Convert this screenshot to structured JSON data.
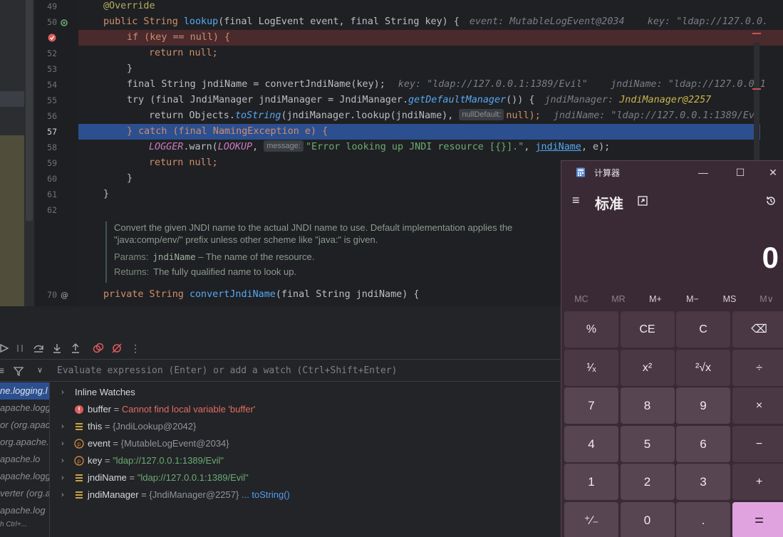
{
  "editor": {
    "lines": [
      {
        "num": "49",
        "top": 0
      },
      {
        "num": "50"
      },
      {
        "num": ""
      },
      {
        "num": "52"
      },
      {
        "num": "53"
      },
      {
        "num": "54"
      },
      {
        "num": "55"
      },
      {
        "num": "56"
      },
      {
        "num": "57"
      },
      {
        "num": "58"
      },
      {
        "num": "59"
      },
      {
        "num": "60"
      },
      {
        "num": "61"
      },
      {
        "num": "62"
      },
      {
        "num": "70"
      }
    ],
    "code": {
      "l49": "@Override",
      "l50_a": "public String ",
      "l50_fn": "lookup",
      "l50_b": "(final LogEvent event, final String key) {",
      "l50_hint": "event: MutableLogEvent@2034    key: \"ldap://127.0.0.",
      "l51": "if (key == null) {",
      "l52": "return null;",
      "l53": "}",
      "l54": "final String jndiName = convertJndiName(key);",
      "l54_hint": "key: \"ldap://127.0.0.1:1389/Evil\"    jndiName: \"ldap://127.0.0.1",
      "l55_a": "try (final JndiManager jndiManager = JndiManager.",
      "l55_fn": "getDefaultManager",
      "l55_b": "()) {",
      "l55_hint_label": "jndiManager: ",
      "l55_hint_obj": "JndiManager@2257",
      "l56_a": "return Objects.",
      "l56_fn": "toString",
      "l56_b": "(jndiManager.lookup(jndiName),",
      "l56_param": "nullDefault:",
      "l56_c": "null);",
      "l56_hint": "jndiName: \"ldap://127.0.0.1:1389/Evi",
      "l57": "} catch (final NamingException e) {",
      "l58_a": "LOGGER",
      "l58_b": ".warn(",
      "l58_c": "LOOKUP",
      "l58_d": ",",
      "l58_param": "message:",
      "l58_str": "\"Error looking up JNDI resource [{}].\"",
      "l58_e": ", ",
      "l58_link": "jndiName",
      "l58_f": ", e);",
      "l59": "return null;",
      "l60": "}",
      "l61": "}",
      "l70_a": "private String ",
      "l70_fn": "convertJndiName",
      "l70_b": "(final String jndiName) {"
    },
    "doc": {
      "line1": "Convert the given JNDI name to the actual JNDI name to use. Default implementation applies the",
      "line2": "\"java:comp/env/\" prefix unless other scheme like \"java:\" is given.",
      "params_label": "Params:",
      "params_code": "jndiName",
      "params_text": " – The name of the resource.",
      "returns_label": "Returns:",
      "returns_text": "The fully qualified name to look up."
    }
  },
  "debug": {
    "eval_placeholder": "Evaluate expression (Enter) or add a watch (Ctrl+Shift+Enter)",
    "frames": [
      "ne.logging.l",
      "apache.logging",
      "or (org.apache",
      "org.apache.",
      "apache.lo",
      "apache.logg",
      "verter (org.a",
      "apache.log",
      "h Ctrl+..."
    ],
    "vars": [
      {
        "name": "Inline Watches",
        "kind": "header"
      },
      {
        "name": "buffer",
        "value": "Cannot find local variable 'buffer'",
        "kind": "error"
      },
      {
        "name": "this",
        "value": "{JndiLookup@2042}",
        "kind": "obj"
      },
      {
        "name": "event",
        "value": "{MutableLogEvent@2034}",
        "kind": "param"
      },
      {
        "name": "key",
        "value": "\"ldap://127.0.0.1:1389/Evil\"",
        "kind": "param-str"
      },
      {
        "name": "jndiName",
        "value": "\"ldap://127.0.0.1:1389/Evil\"",
        "kind": "str"
      },
      {
        "name": "jndiManager",
        "value": "{JndiManager@2257}",
        "link": "... toString()",
        "kind": "obj"
      }
    ]
  },
  "calculator": {
    "title": "计算器",
    "mode": "标准",
    "display": "0",
    "memory": [
      "MC",
      "MR",
      "M+",
      "M−",
      "MS",
      "M∨"
    ],
    "keys": [
      [
        "%",
        "CE",
        "C",
        "⌫"
      ],
      [
        "¹⁄ₓ",
        "x²",
        "²√x",
        "÷"
      ],
      [
        "7",
        "8",
        "9",
        "×"
      ],
      [
        "4",
        "5",
        "6",
        "−"
      ],
      [
        "1",
        "2",
        "3",
        "+"
      ],
      [
        "⁺⁄₋",
        "0",
        ".",
        "="
      ]
    ]
  }
}
